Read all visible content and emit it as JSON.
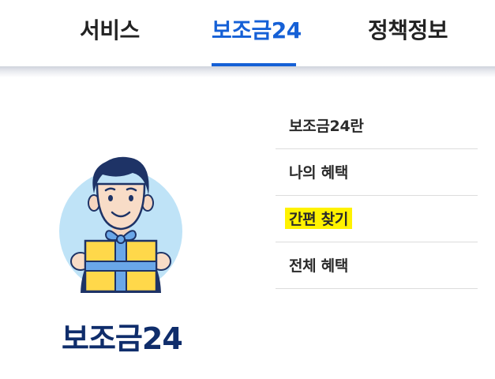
{
  "nav": {
    "tabs": [
      {
        "label": "서비스"
      },
      {
        "label": "보조금24"
      },
      {
        "label": "정책정보"
      }
    ],
    "accent_color": "#1560d6"
  },
  "brand": {
    "title": "보조금24",
    "mascot_icon": "mascot-holding-gift-icon"
  },
  "submenu": {
    "items": [
      {
        "label": "보조금24란"
      },
      {
        "label": "나의 혜택"
      },
      {
        "label": "간편 찾기",
        "highlight_color": "#fff200"
      },
      {
        "label": "전체 혜택"
      }
    ]
  }
}
